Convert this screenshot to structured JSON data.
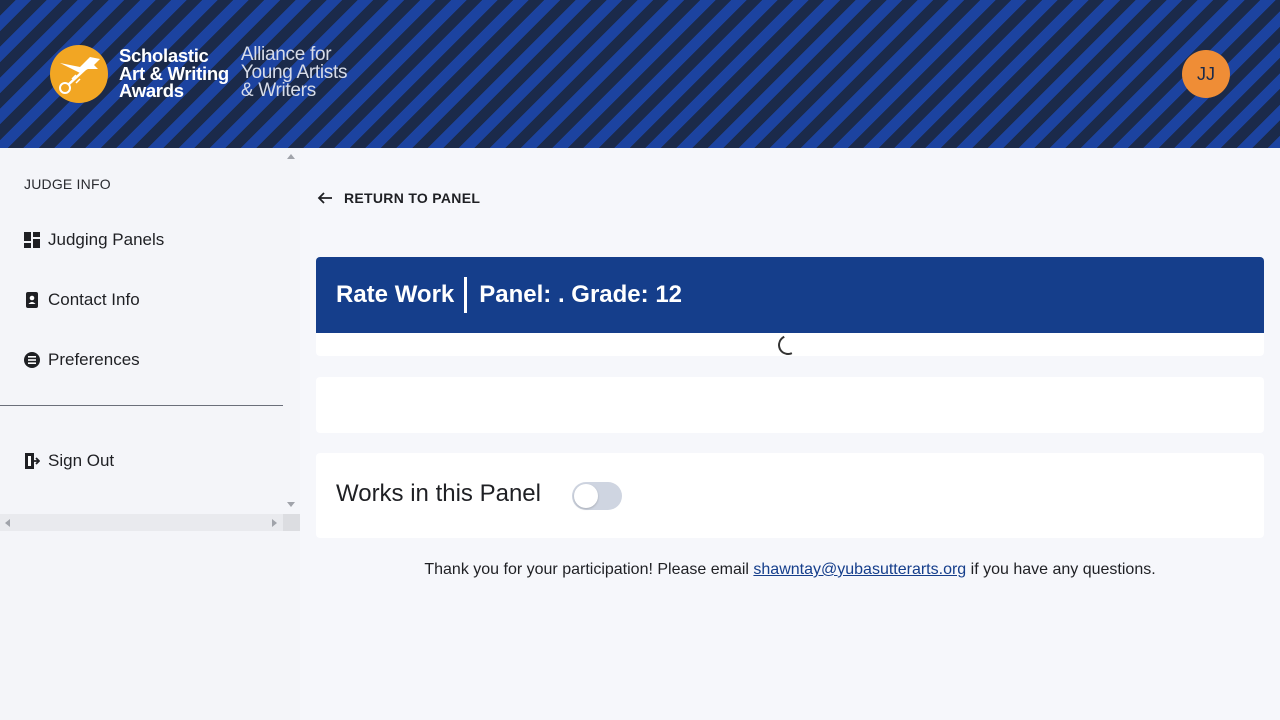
{
  "header": {
    "logo_main": [
      "Scholastic",
      "Art & Writing",
      "Awards"
    ],
    "logo_sub": [
      "Alliance for",
      "Young Artists",
      "& Writers"
    ],
    "avatar_initials": "JJ"
  },
  "sidebar": {
    "heading": "JUDGE INFO",
    "items": [
      {
        "label": "Judging Panels",
        "icon": "dashboard-icon"
      },
      {
        "label": "Contact Info",
        "icon": "contact-card-icon"
      },
      {
        "label": "Preferences",
        "icon": "preferences-icon"
      }
    ],
    "sign_out": {
      "label": "Sign Out",
      "icon": "sign-out-icon"
    }
  },
  "main": {
    "return_label": "RETURN TO PANEL",
    "rate_title": "Rate Work",
    "panel_info": "Panel: . Grade: 12",
    "works_title": "Works in this Panel",
    "works_toggle_on": false,
    "footer": {
      "before": "Thank you for your participation! Please email ",
      "email": "shawntay@yubasutterarts.org",
      "after": " if you have any questions."
    }
  },
  "colors": {
    "header_stripe_dark": "#1b2a4a",
    "header_stripe_blue": "#1c43a0",
    "card_header": "#153e8b",
    "avatar": "#ef8d36",
    "logo_circle": "#f2a623"
  }
}
